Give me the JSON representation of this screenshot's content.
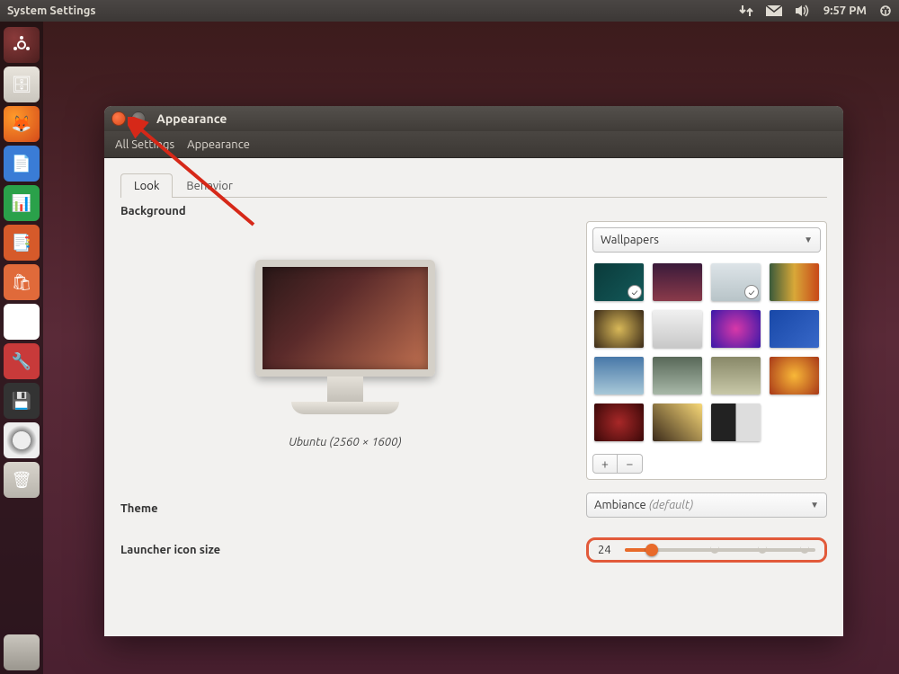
{
  "menubar": {
    "title": "System Settings",
    "time": "9:57 PM"
  },
  "launcher_items": [
    "dash",
    "files",
    "firefox",
    "writer",
    "calc",
    "impress",
    "software",
    "amazon",
    "settings",
    "floppy",
    "disc",
    "trash"
  ],
  "window": {
    "title": "Appearance",
    "breadcrumbs": {
      "root": "All Settings",
      "current": "Appearance"
    },
    "tabs": {
      "look": "Look",
      "behavior": "Behavior"
    },
    "background": {
      "label": "Background",
      "caption": "Ubuntu (2560 × 1600)",
      "source_dropdown": "Wallpapers",
      "add": "+",
      "remove": "−"
    },
    "theme": {
      "label": "Theme",
      "value": "Ambiance",
      "suffix": "(default)"
    },
    "launcher": {
      "label": "Launcher icon size",
      "value": "24"
    }
  }
}
